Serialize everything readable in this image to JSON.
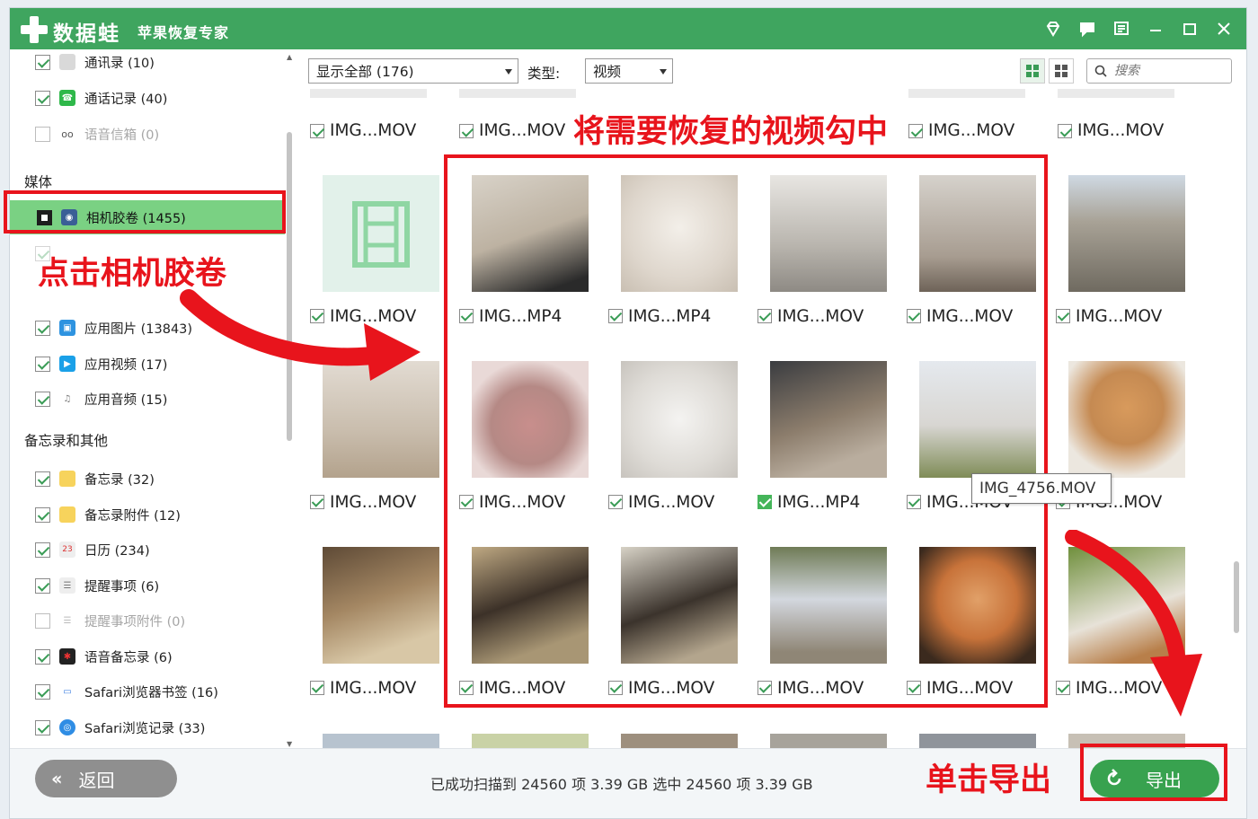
{
  "app": {
    "brand": "数据蛙",
    "title": "苹果恢复专家"
  },
  "sidebar": {
    "items_top": [
      {
        "label": "通讯录 (10)",
        "checked": true,
        "icon": "contacts-icon",
        "disabled": false
      },
      {
        "label": "通话记录 (40)",
        "checked": true,
        "icon": "phone-icon",
        "disabled": false
      },
      {
        "label": "语音信箱 (0)",
        "checked": false,
        "icon": "voicemail-icon",
        "disabled": true
      }
    ],
    "section_media": "媒体",
    "selected_item": {
      "label": "相机胶卷 (1455)",
      "icon": "camera-roll-icon"
    },
    "items_media": [
      {
        "label": "应用图片 (13843)",
        "checked": true,
        "icon": "app-photo-icon"
      },
      {
        "label": "应用视频 (17)",
        "checked": true,
        "icon": "app-video-icon"
      },
      {
        "label": "应用音频 (15)",
        "checked": true,
        "icon": "app-audio-icon"
      }
    ],
    "section_notes": "备忘录和其他",
    "items_notes": [
      {
        "label": "备忘录 (32)",
        "checked": true,
        "icon": "notes-icon",
        "disabled": false
      },
      {
        "label": "备忘录附件 (12)",
        "checked": true,
        "icon": "notes-attachment-icon",
        "disabled": false
      },
      {
        "label": "日历 (234)",
        "checked": true,
        "icon": "calendar-icon",
        "disabled": false
      },
      {
        "label": "提醒事项 (6)",
        "checked": true,
        "icon": "reminders-icon",
        "disabled": false
      },
      {
        "label": "提醒事项附件 (0)",
        "checked": false,
        "icon": "reminders-attachment-icon",
        "disabled": true
      },
      {
        "label": "语音备忘录 (6)",
        "checked": true,
        "icon": "voice-memo-icon",
        "disabled": false
      },
      {
        "label": "Safari浏览器书签 (16)",
        "checked": true,
        "icon": "safari-bookmark-icon",
        "disabled": false
      },
      {
        "label": "Safari浏览记录 (33)",
        "checked": true,
        "icon": "safari-history-icon",
        "disabled": false
      }
    ]
  },
  "toolbar": {
    "filter_value": "显示全部 (176)",
    "type_label": "类型:",
    "type_value": "视频",
    "search_placeholder": "搜索"
  },
  "grid": {
    "top_row": [
      "IMG...MOV",
      "IMG...MOV",
      "IMG...MOV",
      "IMG...MOV"
    ],
    "rows": [
      [
        "IMG...MOV",
        "IMG...MP4",
        "IMG...MP4",
        "IMG...MOV",
        "IMG...MOV",
        "IMG...MOV"
      ],
      [
        "IMG...MOV",
        "IMG...MOV",
        "IMG...MOV",
        "IMG...MP4",
        "IMG...MOV",
        "IMG...MOV"
      ],
      [
        "IMG...MOV",
        "IMG...MOV",
        "IMG...MOV",
        "IMG...MOV",
        "IMG...MOV",
        "IMG...MOV"
      ]
    ],
    "tooltip": "IMG_4756.MOV"
  },
  "footer": {
    "back_label": "返回",
    "status": "已成功扫描到 24560 项 3.39 GB   选中 24560 项 3.39 GB",
    "export_label": "导出"
  },
  "annotations": {
    "click_camera_roll": "点击相机胶卷",
    "check_videos": "将需要恢复的视频勾中",
    "click_export": "单击导出"
  },
  "colors": {
    "titlebar": "#3fa55f",
    "selected": "#7ad183",
    "annotation": "#e8141c",
    "export": "#38a24f"
  }
}
